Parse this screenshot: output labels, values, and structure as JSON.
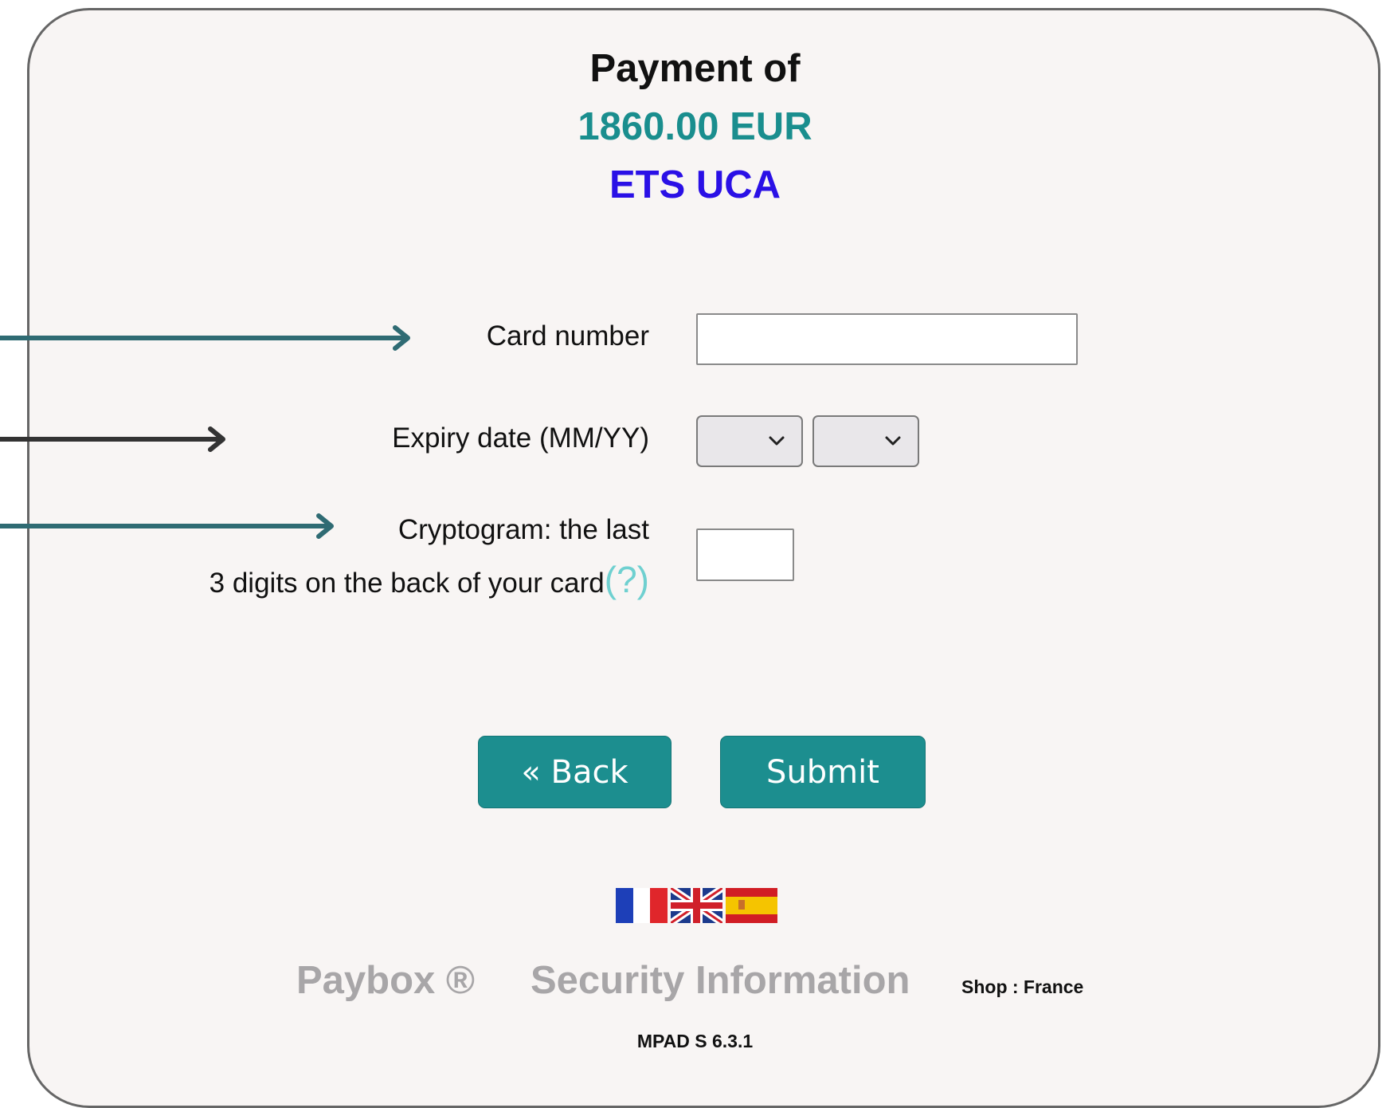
{
  "header": {
    "payment_label": "Payment of",
    "amount": "1860.00 EUR",
    "merchant": "ETS UCA"
  },
  "form": {
    "card_number_label": "Card number",
    "card_number_value": "",
    "expiry_label": "Expiry date (MM/YY)",
    "expiry_month_value": "",
    "expiry_year_value": "",
    "cryptogram_label_line1": "Cryptogram: the last",
    "cryptogram_label_line2": "3 digits on the back of your card",
    "cryptogram_help": "(?)",
    "cryptogram_value": ""
  },
  "buttons": {
    "back_label": "« Back",
    "submit_label": "Submit"
  },
  "languages": [
    {
      "name": "French",
      "icon": "flag-france-icon"
    },
    {
      "name": "English",
      "icon": "flag-uk-icon"
    },
    {
      "name": "Spanish",
      "icon": "flag-spain-icon"
    }
  ],
  "footer": {
    "paybox_label": "Paybox ®",
    "security_label": "Security Information",
    "shop_label": "Shop : France",
    "version_label": "MPAD S 6.3.1"
  },
  "colors": {
    "accent": "#1c8e8f",
    "amount": "#1a8e8e",
    "merchant": "#2a10e6",
    "panel_background": "#f8f5f4",
    "arrow_teal": "#2f6b73",
    "arrow_dark": "#333333"
  }
}
